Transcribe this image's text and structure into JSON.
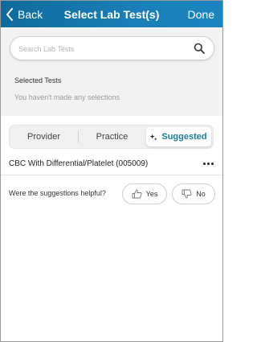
{
  "navbar": {
    "back_label": "Back",
    "title": "Select Lab Test(s)",
    "done_label": "Done",
    "gradient_start": "#0e6a9c",
    "gradient_end": "#1b84bf"
  },
  "search": {
    "placeholder": "Search Lab Tests",
    "value": "",
    "icon": "search-icon"
  },
  "selected": {
    "heading": "Selected Tests",
    "empty_text": "You haven't made any selections"
  },
  "tabs": [
    {
      "label": "Provider",
      "active": false
    },
    {
      "label": "Practice",
      "active": false
    },
    {
      "label": "Suggested",
      "active": true,
      "icon": "sparkle-icon"
    }
  ],
  "accent_color": "#1b7d9c",
  "results": [
    {
      "name": "CBC With Differential/Platelet (005009)",
      "menu_icon": "more-icon"
    }
  ],
  "feedback": {
    "question": "Were the suggestions helpful?",
    "yes_label": "Yes",
    "no_label": "No"
  }
}
